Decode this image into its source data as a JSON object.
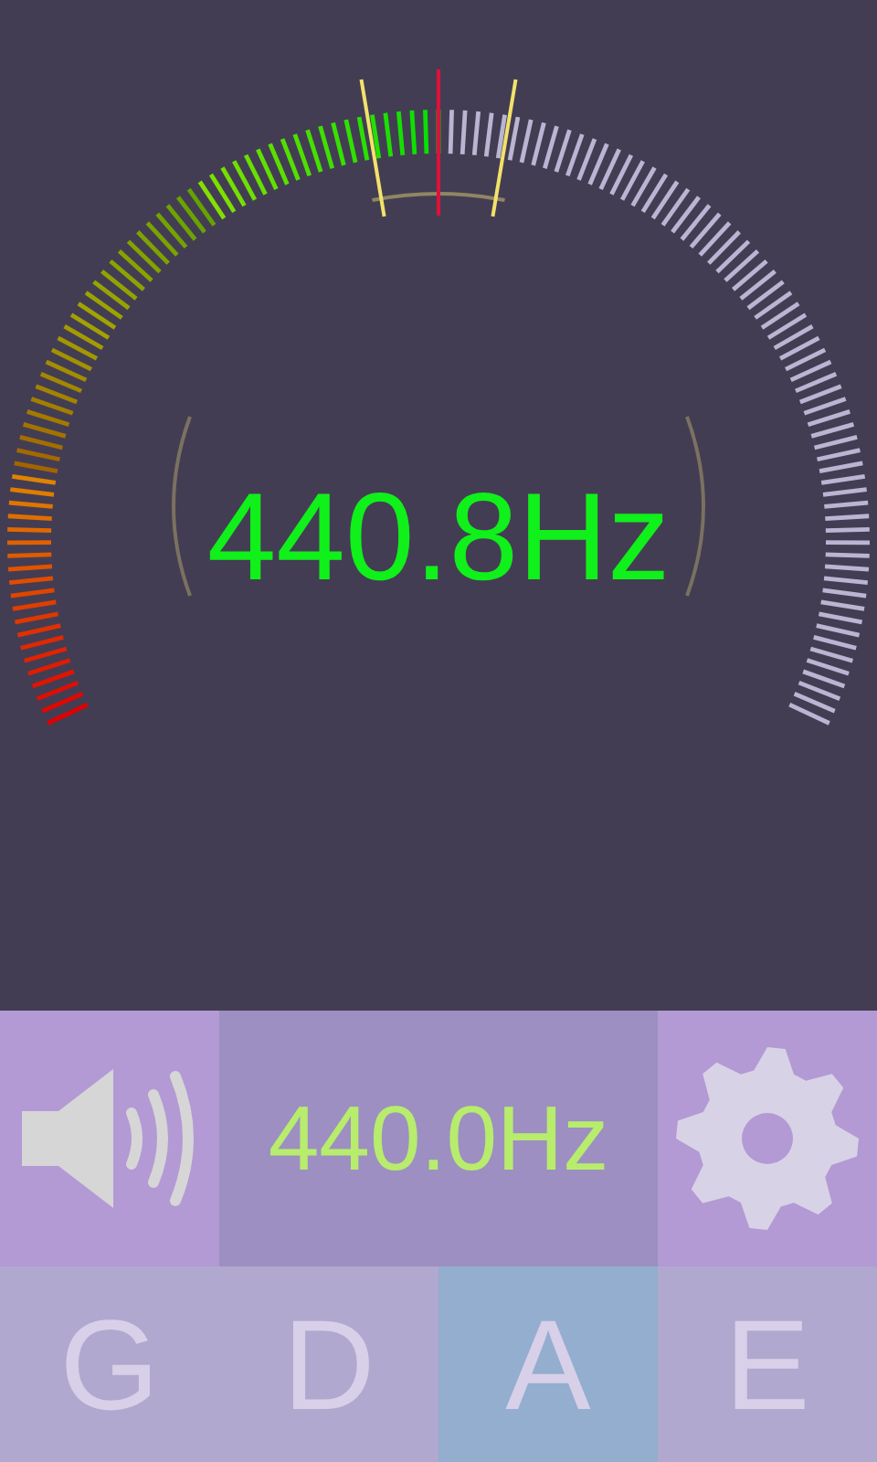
{
  "reading": "440.8Hz",
  "meter": {
    "level": 0.5
  },
  "reference": "440.0Hz",
  "strings": [
    {
      "label": "G",
      "selected": false
    },
    {
      "label": "D",
      "selected": false
    },
    {
      "label": "A",
      "selected": true
    },
    {
      "label": "E",
      "selected": false
    }
  ]
}
